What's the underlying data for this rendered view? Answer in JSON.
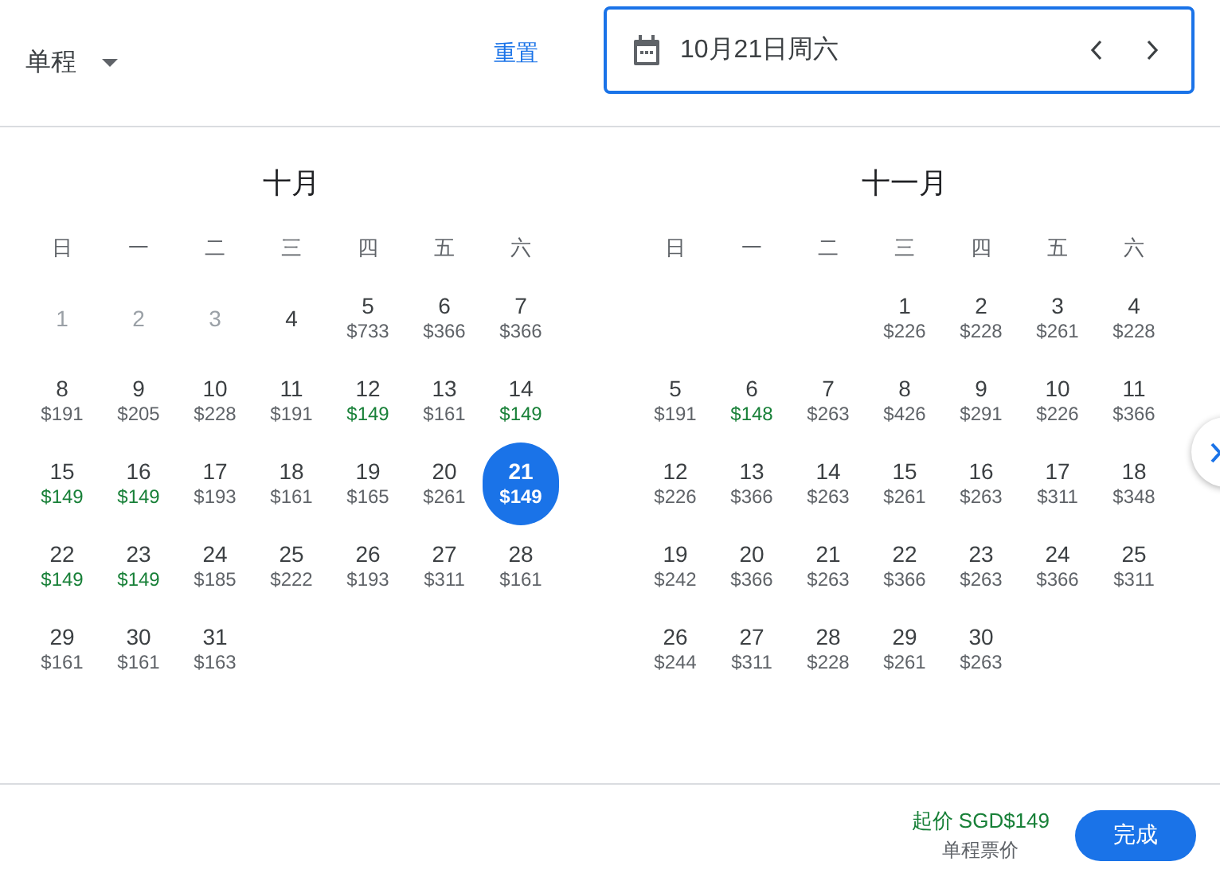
{
  "trip_type": {
    "label": "单程"
  },
  "reset_link": "重置",
  "date_field": {
    "value": "10月21日周六"
  },
  "months": [
    {
      "title": "十月",
      "weekdays": [
        "日",
        "一",
        "二",
        "三",
        "四",
        "五",
        "六"
      ],
      "days": [
        {
          "kind": "day",
          "day": "1",
          "disabled": true,
          "selected": false
        },
        {
          "kind": "day",
          "day": "2",
          "disabled": true,
          "selected": false
        },
        {
          "kind": "day",
          "day": "3",
          "disabled": true,
          "selected": false
        },
        {
          "kind": "day",
          "day": "4",
          "disabled": false,
          "selected": false
        },
        {
          "kind": "day",
          "day": "5",
          "price": "$733",
          "disabled": false,
          "cheap": false,
          "selected": false
        },
        {
          "kind": "day",
          "day": "6",
          "price": "$366",
          "disabled": false,
          "cheap": false,
          "selected": false
        },
        {
          "kind": "day",
          "day": "7",
          "price": "$366",
          "disabled": false,
          "cheap": false,
          "selected": false
        },
        {
          "kind": "day",
          "day": "8",
          "price": "$191",
          "disabled": false,
          "cheap": false,
          "selected": false
        },
        {
          "kind": "day",
          "day": "9",
          "price": "$205",
          "disabled": false,
          "cheap": false,
          "selected": false
        },
        {
          "kind": "day",
          "day": "10",
          "price": "$228",
          "disabled": false,
          "cheap": false,
          "selected": false
        },
        {
          "kind": "day",
          "day": "11",
          "price": "$191",
          "disabled": false,
          "cheap": false,
          "selected": false
        },
        {
          "kind": "day",
          "day": "12",
          "price": "$149",
          "disabled": false,
          "cheap": true,
          "selected": false
        },
        {
          "kind": "day",
          "day": "13",
          "price": "$161",
          "disabled": false,
          "cheap": false,
          "selected": false
        },
        {
          "kind": "day",
          "day": "14",
          "price": "$149",
          "disabled": false,
          "cheap": true,
          "selected": false
        },
        {
          "kind": "day",
          "day": "15",
          "price": "$149",
          "disabled": false,
          "cheap": true,
          "selected": false
        },
        {
          "kind": "day",
          "day": "16",
          "price": "$149",
          "disabled": false,
          "cheap": true,
          "selected": false
        },
        {
          "kind": "day",
          "day": "17",
          "price": "$193",
          "disabled": false,
          "cheap": false,
          "selected": false
        },
        {
          "kind": "day",
          "day": "18",
          "price": "$161",
          "disabled": false,
          "cheap": false,
          "selected": false
        },
        {
          "kind": "day",
          "day": "19",
          "price": "$165",
          "disabled": false,
          "cheap": false,
          "selected": false
        },
        {
          "kind": "day",
          "day": "20",
          "price": "$261",
          "disabled": false,
          "cheap": false,
          "selected": false
        },
        {
          "kind": "day",
          "day": "21",
          "price": "$149",
          "disabled": false,
          "cheap": true,
          "selected": true
        },
        {
          "kind": "day",
          "day": "22",
          "price": "$149",
          "disabled": false,
          "cheap": true,
          "selected": false
        },
        {
          "kind": "day",
          "day": "23",
          "price": "$149",
          "disabled": false,
          "cheap": true,
          "selected": false
        },
        {
          "kind": "day",
          "day": "24",
          "price": "$185",
          "disabled": false,
          "cheap": false,
          "selected": false
        },
        {
          "kind": "day",
          "day": "25",
          "price": "$222",
          "disabled": false,
          "cheap": false,
          "selected": false
        },
        {
          "kind": "day",
          "day": "26",
          "price": "$193",
          "disabled": false,
          "cheap": false,
          "selected": false
        },
        {
          "kind": "day",
          "day": "27",
          "price": "$311",
          "disabled": false,
          "cheap": false,
          "selected": false
        },
        {
          "kind": "day",
          "day": "28",
          "price": "$161",
          "disabled": false,
          "cheap": false,
          "selected": false
        },
        {
          "kind": "day",
          "day": "29",
          "price": "$161",
          "disabled": false,
          "cheap": false,
          "selected": false
        },
        {
          "kind": "day",
          "day": "30",
          "price": "$161",
          "disabled": false,
          "cheap": false,
          "selected": false
        },
        {
          "kind": "day",
          "day": "31",
          "price": "$163",
          "disabled": false,
          "cheap": false,
          "selected": false
        }
      ]
    },
    {
      "title": "十一月",
      "weekdays": [
        "日",
        "一",
        "二",
        "三",
        "四",
        "五",
        "六"
      ],
      "days": [
        {
          "kind": "blank"
        },
        {
          "kind": "blank"
        },
        {
          "kind": "blank"
        },
        {
          "kind": "day",
          "day": "1",
          "price": "$226",
          "disabled": false,
          "cheap": false,
          "selected": false
        },
        {
          "kind": "day",
          "day": "2",
          "price": "$228",
          "disabled": false,
          "cheap": false,
          "selected": false
        },
        {
          "kind": "day",
          "day": "3",
          "price": "$261",
          "disabled": false,
          "cheap": false,
          "selected": false
        },
        {
          "kind": "day",
          "day": "4",
          "price": "$228",
          "disabled": false,
          "cheap": false,
          "selected": false
        },
        {
          "kind": "day",
          "day": "5",
          "price": "$191",
          "disabled": false,
          "cheap": false,
          "selected": false
        },
        {
          "kind": "day",
          "day": "6",
          "price": "$148",
          "disabled": false,
          "cheap": true,
          "selected": false
        },
        {
          "kind": "day",
          "day": "7",
          "price": "$263",
          "disabled": false,
          "cheap": false,
          "selected": false
        },
        {
          "kind": "day",
          "day": "8",
          "price": "$426",
          "disabled": false,
          "cheap": false,
          "selected": false
        },
        {
          "kind": "day",
          "day": "9",
          "price": "$291",
          "disabled": false,
          "cheap": false,
          "selected": false
        },
        {
          "kind": "day",
          "day": "10",
          "price": "$226",
          "disabled": false,
          "cheap": false,
          "selected": false
        },
        {
          "kind": "day",
          "day": "11",
          "price": "$366",
          "disabled": false,
          "cheap": false,
          "selected": false
        },
        {
          "kind": "day",
          "day": "12",
          "price": "$226",
          "disabled": false,
          "cheap": false,
          "selected": false
        },
        {
          "kind": "day",
          "day": "13",
          "price": "$366",
          "disabled": false,
          "cheap": false,
          "selected": false
        },
        {
          "kind": "day",
          "day": "14",
          "price": "$263",
          "disabled": false,
          "cheap": false,
          "selected": false
        },
        {
          "kind": "day",
          "day": "15",
          "price": "$261",
          "disabled": false,
          "cheap": false,
          "selected": false
        },
        {
          "kind": "day",
          "day": "16",
          "price": "$263",
          "disabled": false,
          "cheap": false,
          "selected": false
        },
        {
          "kind": "day",
          "day": "17",
          "price": "$311",
          "disabled": false,
          "cheap": false,
          "selected": false
        },
        {
          "kind": "day",
          "day": "18",
          "price": "$348",
          "disabled": false,
          "cheap": false,
          "selected": false
        },
        {
          "kind": "day",
          "day": "19",
          "price": "$242",
          "disabled": false,
          "cheap": false,
          "selected": false
        },
        {
          "kind": "day",
          "day": "20",
          "price": "$366",
          "disabled": false,
          "cheap": false,
          "selected": false
        },
        {
          "kind": "day",
          "day": "21",
          "price": "$263",
          "disabled": false,
          "cheap": false,
          "selected": false
        },
        {
          "kind": "day",
          "day": "22",
          "price": "$366",
          "disabled": false,
          "cheap": false,
          "selected": false
        },
        {
          "kind": "day",
          "day": "23",
          "price": "$263",
          "disabled": false,
          "cheap": false,
          "selected": false
        },
        {
          "kind": "day",
          "day": "24",
          "price": "$366",
          "disabled": false,
          "cheap": false,
          "selected": false
        },
        {
          "kind": "day",
          "day": "25",
          "price": "$311",
          "disabled": false,
          "cheap": false,
          "selected": false
        },
        {
          "kind": "day",
          "day": "26",
          "price": "$244",
          "disabled": false,
          "cheap": false,
          "selected": false
        },
        {
          "kind": "day",
          "day": "27",
          "price": "$311",
          "disabled": false,
          "cheap": false,
          "selected": false
        },
        {
          "kind": "day",
          "day": "28",
          "price": "$228",
          "disabled": false,
          "cheap": false,
          "selected": false
        },
        {
          "kind": "day",
          "day": "29",
          "price": "$261",
          "disabled": false,
          "cheap": false,
          "selected": false
        },
        {
          "kind": "day",
          "day": "30",
          "price": "$263",
          "disabled": false,
          "cheap": false,
          "selected": false
        }
      ]
    }
  ],
  "footer": {
    "price_from": "起价 SGD$149",
    "price_note": "单程票价",
    "done_button": "完成"
  }
}
